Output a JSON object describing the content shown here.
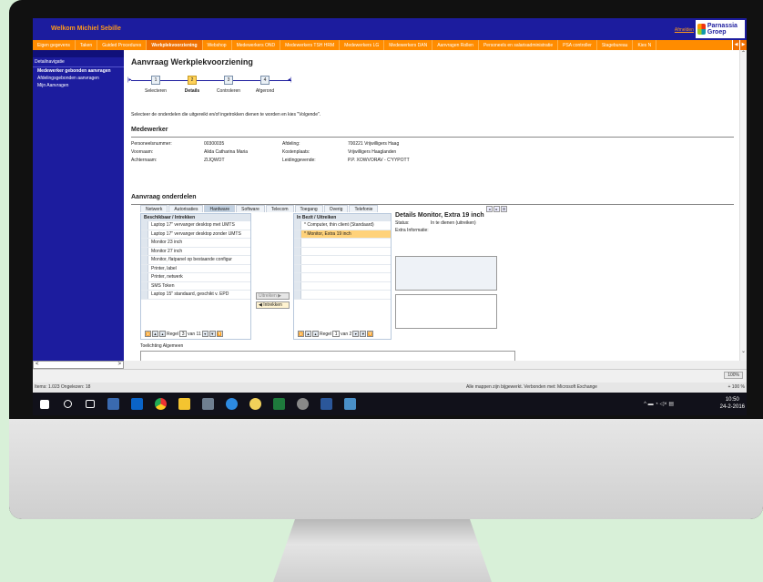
{
  "header": {
    "welcome": "Welkom Michiel Sebille",
    "logout": "Afmelden",
    "logo_text": "Parnassia Groep"
  },
  "nav": {
    "tabs": [
      {
        "label": "Eigen gegevens",
        "active": false
      },
      {
        "label": "Taken",
        "active": false
      },
      {
        "label": "Guided Procedures",
        "active": false
      },
      {
        "label": "Werkplekvoorziening",
        "active": true
      },
      {
        "label": "Webshop",
        "active": false
      },
      {
        "label": "Medewerkers OND",
        "active": false
      },
      {
        "label": "Medewerkers TSH HRM",
        "active": false
      },
      {
        "label": "Medewerkers LG",
        "active": false
      },
      {
        "label": "Medewerkers DAN",
        "active": false
      },
      {
        "label": "Aanvragen Rollen",
        "active": false
      },
      {
        "label": "Personeels en salarisadministratie",
        "active": false
      },
      {
        "label": "PSA controller",
        "active": false
      },
      {
        "label": "Stagebureau",
        "active": false
      },
      {
        "label": "Kies N",
        "active": false
      }
    ]
  },
  "sidebar": {
    "title": "Detailnavigatie",
    "items": [
      {
        "label": "Medewerker gebonden aanvragen",
        "active": true
      },
      {
        "label": "Afdelingsgebonden aanvragen",
        "active": false
      },
      {
        "label": "Mijn Aanvragen",
        "active": false
      }
    ]
  },
  "page": {
    "title": "Aanvraag Werkplekvoorziening",
    "steps": [
      {
        "num": "1",
        "label": "Selecteren",
        "active": false
      },
      {
        "num": "2",
        "label": "Details",
        "active": true
      },
      {
        "num": "3",
        "label": "Controleren",
        "active": false
      },
      {
        "num": "4",
        "label": "Afgerond",
        "active": false
      }
    ],
    "instruction": "Selecteer de onderdelen die uitgereikt en/of ingetrokken dienen te worden en kies \"Volgende\"."
  },
  "employee": {
    "section_title": "Medewerker",
    "personeelsnummer_label": "Personeelsnummer:",
    "personeelsnummer": "00300035",
    "voornaam_label": "Voornaam:",
    "voornaam": "Alida Catharina Maria",
    "achternaam_label": "Achternaam:",
    "achternaam": "ZIJQWOT",
    "afdeling_label": "Afdeling:",
    "afdeling": "700221 Vrijwilligers Haag",
    "kostenplaats_label": "Kostenplaats:",
    "kostenplaats": "Vrijwilligers Haaglanden",
    "leidinggevende_label": "Leidinggevende:",
    "leidinggevende": "P.P. XOWVORAV - C'YYPOTT"
  },
  "onderdelen": {
    "section_title": "Aanvraag onderdelen",
    "tabs": [
      {
        "label": "Netwerk",
        "active": false
      },
      {
        "label": "Autorisaties",
        "active": false
      },
      {
        "label": "Hardware",
        "active": true
      },
      {
        "label": "Software",
        "active": false
      },
      {
        "label": "Telecom",
        "active": false
      },
      {
        "label": "Toegang",
        "active": false
      },
      {
        "label": "Overig",
        "active": false
      },
      {
        "label": "Telefonie",
        "active": false
      }
    ],
    "available": {
      "header": "Beschikbaar / Intrekken",
      "items": [
        "Laptop 17\" vervanger desktop met UMTS",
        "Laptop 17\" vervanger desktop zonder UMTS",
        "Monitor 23 inch",
        "Monitor 27 inch",
        "Monitor, flatpanel op bestaande configur",
        "Printer, label",
        "Printer, netwerk",
        "SMS Token",
        "Laptop 15\" standaard, geschikt v. EPD"
      ],
      "pager_label": "Regel",
      "page": "3",
      "of": "van 11"
    },
    "buttons": {
      "uitreiken": "Uitreiken",
      "intrekken": "Intrekken"
    },
    "owned": {
      "header": "In Bezit / Uitreiken",
      "items": [
        {
          "label": "* Computer, thin client (Standaard)",
          "selected": false
        },
        {
          "label": "* Monitor, Extra 19 inch",
          "selected": true
        }
      ],
      "pager_label": "Regel",
      "page": "1",
      "of": "van 2"
    },
    "details": {
      "title": "Details Monitor, Extra 19 inch",
      "status_label": "Status:",
      "status_value": "In te dienen (uitreiken)",
      "extra_label": "Extra Informatie:"
    },
    "toelichting_label": "Toelichting Algemeen"
  },
  "statusbar": {
    "zoom": "100%",
    "items_text": "Items: 1.023   Ongelezen: 18",
    "sync_text": "Alle mappen zijn bijgewerkt.   Verbonden met: Microsoft Exchange",
    "zoom_right": "+ 100 %"
  },
  "taskbar": {
    "time": "10:50",
    "date": "24-2-2016"
  },
  "colors": {
    "brand_blue": "#1c1c9e",
    "brand_orange": "#ff8c00",
    "selected_row": "#ffd27a"
  }
}
